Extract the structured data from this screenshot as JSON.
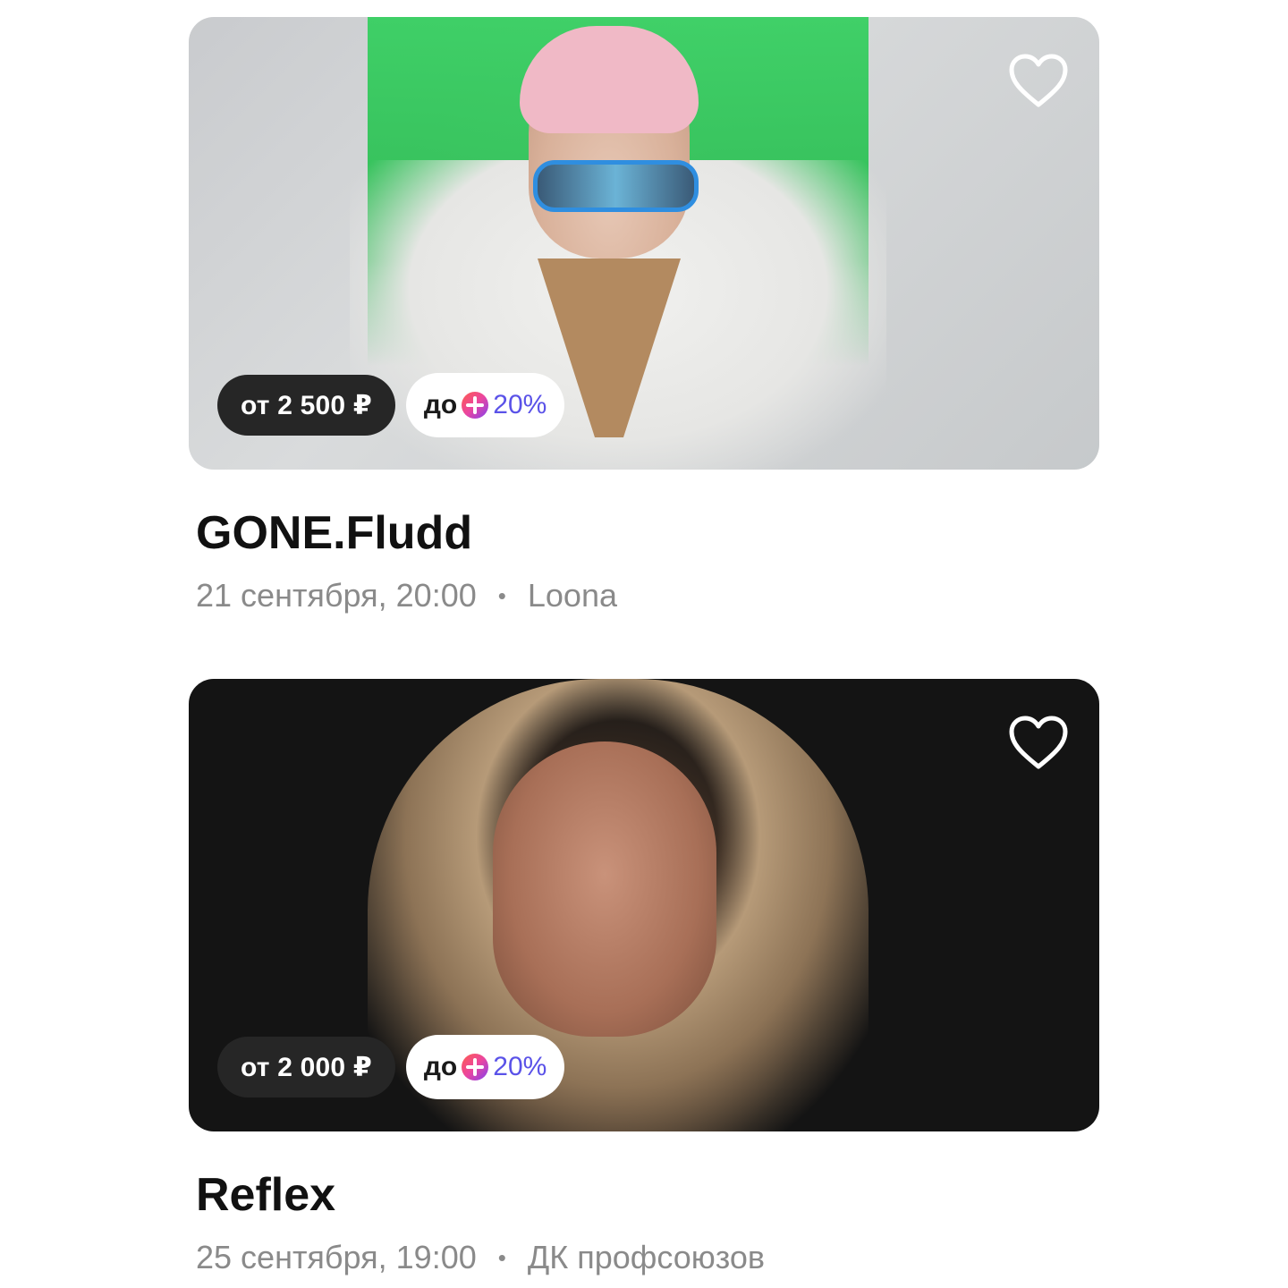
{
  "events": [
    {
      "title": "GONE.Fludd",
      "date": "21 сентября, 20:00",
      "separator": "•",
      "venue": "Loona",
      "price": "от 2 500 ₽",
      "plus_prefix": "до",
      "plus_percent": "20%",
      "image_theme": "light"
    },
    {
      "title": "Reflex",
      "date": "25 сентября, 19:00",
      "separator": "•",
      "venue": "ДК профсоюзов",
      "price": "от 2 000 ₽",
      "plus_prefix": "до",
      "plus_percent": "20%",
      "image_theme": "dark"
    }
  ],
  "icons": {
    "favorite": "heart-outline-icon",
    "plus": "yandex-plus-icon"
  },
  "colors": {
    "price_badge_bg": "#262626",
    "plus_percent": "#5a52e8",
    "meta_text": "#8a8a8a"
  }
}
